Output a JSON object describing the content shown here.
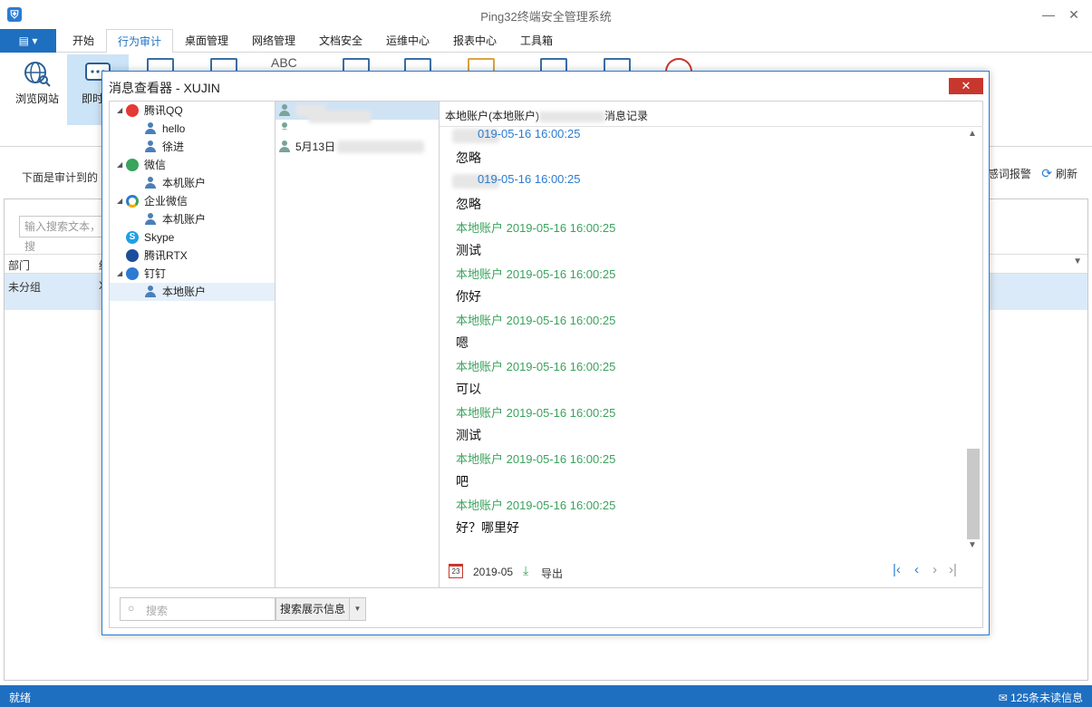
{
  "window": {
    "title": "Ping32终端安全管理系统",
    "app_icon": "shield-icon"
  },
  "menu": {
    "items": [
      "开始",
      "行为审计",
      "桌面管理",
      "网络管理",
      "文档安全",
      "运维中心",
      "报表中心",
      "工具箱"
    ],
    "active_index": 1
  },
  "ribbon": {
    "buttons": [
      {
        "label": "浏览网站",
        "icon": "globe-icon"
      },
      {
        "label": "即时通",
        "icon": "chat-icon"
      }
    ],
    "abc_label": "ABC"
  },
  "main": {
    "description": "下面是审计到的",
    "links": {
      "keyword_alert": "感词报警",
      "refresh": "刷新"
    },
    "search_placeholder": "输入搜索文本，搜",
    "columns": [
      "部门",
      "终"
    ],
    "rows": [
      {
        "dept": "未分组",
        "rest": "X"
      }
    ]
  },
  "status": {
    "left": "就绪",
    "unread": "125条未读信息"
  },
  "dialog": {
    "title": "消息查看器 - XUJIN",
    "close_label": "✕",
    "tree": [
      {
        "label": "腾讯QQ",
        "level": 0,
        "icon": "qq-icon",
        "color": "#e53935"
      },
      {
        "label": "hello",
        "level": 1
      },
      {
        "label": "徐进",
        "level": 1
      },
      {
        "label": "微信",
        "level": 0,
        "icon": "wechat-icon",
        "color": "#3aa35c"
      },
      {
        "label": "本机账户",
        "level": 1
      },
      {
        "label": "企业微信",
        "level": 0,
        "icon": "wecom-icon",
        "color": "#2b7bd3"
      },
      {
        "label": "本机账户",
        "level": 1
      },
      {
        "label": "Skype",
        "level": 0,
        "icon": "skype-icon",
        "color": "#1da1e6"
      },
      {
        "label": "腾讯RTX",
        "level": 0,
        "icon": "rtx-icon",
        "color": "#1b4f9c"
      },
      {
        "label": "钉钉",
        "level": 0,
        "icon": "dingtalk-icon",
        "color": "#2b7bd3"
      },
      {
        "label": "本地账户",
        "level": 1,
        "selected": true
      }
    ],
    "contacts": [
      {
        "label": ""
      },
      {
        "label": ""
      },
      {
        "label": "5月13日"
      }
    ],
    "chat_header": "本地账户(本地账户)",
    "chat_header_suffix": "消息记录",
    "messages": [
      {
        "meta": "019-05-16 16:00:25",
        "text": "",
        "color": "blue"
      },
      {
        "meta": "",
        "text": "忽略",
        "color": "blue"
      },
      {
        "meta": "019-05-16 16:00:25",
        "text": "",
        "color": "blue"
      },
      {
        "meta": "",
        "text": "忽略",
        "color": "blue"
      },
      {
        "meta": "本地账户 2019-05-16 16:00:25",
        "text": "测试",
        "color": "green"
      },
      {
        "meta": "本地账户 2019-05-16 16:00:25",
        "text": "你好",
        "color": "green"
      },
      {
        "meta": "本地账户 2019-05-16 16:00:25",
        "text": "嗯",
        "color": "green"
      },
      {
        "meta": "本地账户 2019-05-16 16:00:25",
        "text": "可以",
        "color": "green"
      },
      {
        "meta": "本地账户 2019-05-16 16:00:25",
        "text": "测试",
        "color": "green"
      },
      {
        "meta": "本地账户 2019-05-16 16:00:25",
        "text": "吧",
        "color": "green"
      },
      {
        "meta": "本地账户 2019-05-16 16:00:25",
        "text": "好？哪里好",
        "color": "green"
      }
    ],
    "footer": {
      "date": "2019-05",
      "export": "导出",
      "calendar_day": "23"
    },
    "bottom": {
      "search_placeholder": "搜索",
      "button": "搜索展示信息"
    }
  }
}
